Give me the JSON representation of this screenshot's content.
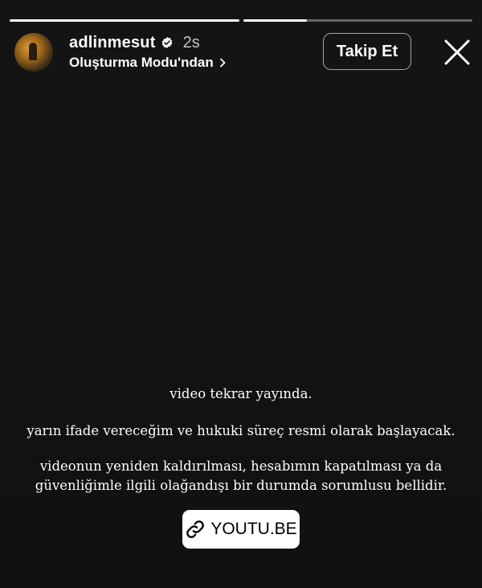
{
  "progress": {
    "segments": [
      {
        "fill": 1.0
      },
      {
        "fill": 0.28
      }
    ]
  },
  "header": {
    "username": "adlinmesut",
    "verified": true,
    "time": "2s",
    "subtitle": "Oluşturma Modu'ndan",
    "follow_label": "Takip Et"
  },
  "icons": {
    "verified": "verified-badge-icon",
    "chevron": "chevron-right-icon",
    "close": "close-icon",
    "link": "link-icon"
  },
  "story_text": {
    "line1": "video tekrar yayında.",
    "line2": "yarın ifade vereceğim ve hukuki süreç resmi olarak başlayacak.",
    "line3": "videonun yeniden kaldırılması, hesabımın kapatılması ya da",
    "line4": "güvenliğimle ilgili olağandışı bir durumda sorumlusu bellidir."
  },
  "link_sticker": {
    "label": "YOUTU.BE"
  }
}
